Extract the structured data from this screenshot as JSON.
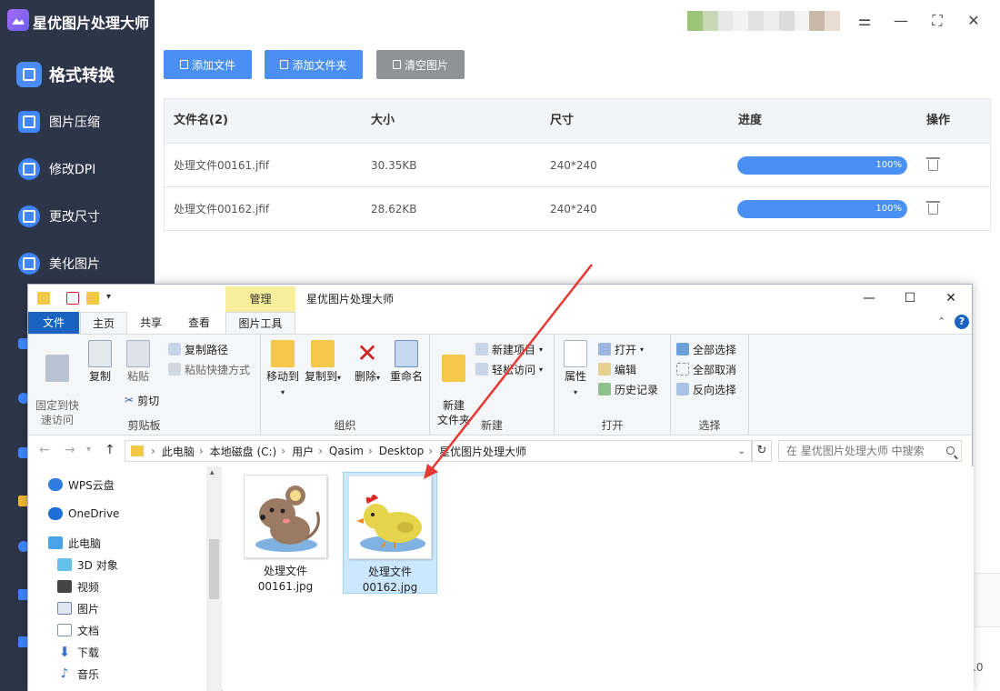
{
  "app": {
    "title": "星优图片处理大师",
    "nav": [
      {
        "label": "格式转换",
        "active": true
      },
      {
        "label": "图片压缩"
      },
      {
        "label": "修改DPI"
      },
      {
        "label": "更改尺寸"
      },
      {
        "label": "美化图片"
      }
    ],
    "buttons": {
      "add_file": "添加文件",
      "add_folder": "添加文件夹",
      "clear": "清空图片"
    },
    "table": {
      "headers": {
        "name": "文件名(2)",
        "size": "大小",
        "dimension": "尺寸",
        "progress": "进度",
        "action": "操作"
      },
      "rows": [
        {
          "name": "处理文件00161.jfif",
          "size": "30.35KB",
          "dimension": "240*240",
          "progress_label": "100%",
          "progress": 1.0
        },
        {
          "name": "处理文件00162.jfif",
          "size": "28.62KB",
          "dimension": "240*240",
          "progress_label": "100%",
          "progress": 1.0
        }
      ]
    },
    "edge_text": ".0",
    "colors": {
      "sidebar": "#2d3648",
      "accent": "#4a8ff2",
      "clear_button": "#8e9299"
    }
  },
  "explorer": {
    "window_title": "星优图片处理大师",
    "manage_tab": "管理",
    "tabs": {
      "file": "文件",
      "home": "主页",
      "share": "共享",
      "view": "查看",
      "picture_tools": "图片工具"
    },
    "clipboard": {
      "pin": "固定到快\n速访问",
      "copy": "复制",
      "paste": "粘贴",
      "copy_path": "复制路径",
      "paste_shortcut": "粘贴快捷方式",
      "cut": "剪切",
      "label": "剪贴板"
    },
    "organize": {
      "move_to": "移动到",
      "copy_to": "复制到",
      "delete": "删除",
      "rename": "重命名",
      "label": "组织"
    },
    "new": {
      "new_folder": "新建\n文件夹",
      "new_item": "新建项目",
      "easy_access": "轻松访问",
      "label": "新建"
    },
    "open": {
      "properties": "属性",
      "open": "打开",
      "edit": "编辑",
      "history": "历史记录",
      "label": "打开"
    },
    "select": {
      "select_all": "全部选择",
      "select_none": "全部取消",
      "invert": "反向选择",
      "label": "选择"
    },
    "breadcrumb": [
      "此电脑",
      "本地磁盘 (C:)",
      "用户",
      "Qasim",
      "Desktop",
      "星优图片处理大师"
    ],
    "search_placeholder": "在 星优图片处理大师 中搜索",
    "tree": [
      "WPS云盘",
      "OneDrive",
      "此电脑",
      "3D 对象",
      "视频",
      "图片",
      "文档",
      "下载",
      "音乐"
    ],
    "files": [
      {
        "name": "处理文件\n00161.jpg",
        "selected": false
      },
      {
        "name": "处理文件\n00162.jpg",
        "selected": true
      }
    ]
  },
  "annotation": {
    "arrow_color": "#e53935"
  }
}
